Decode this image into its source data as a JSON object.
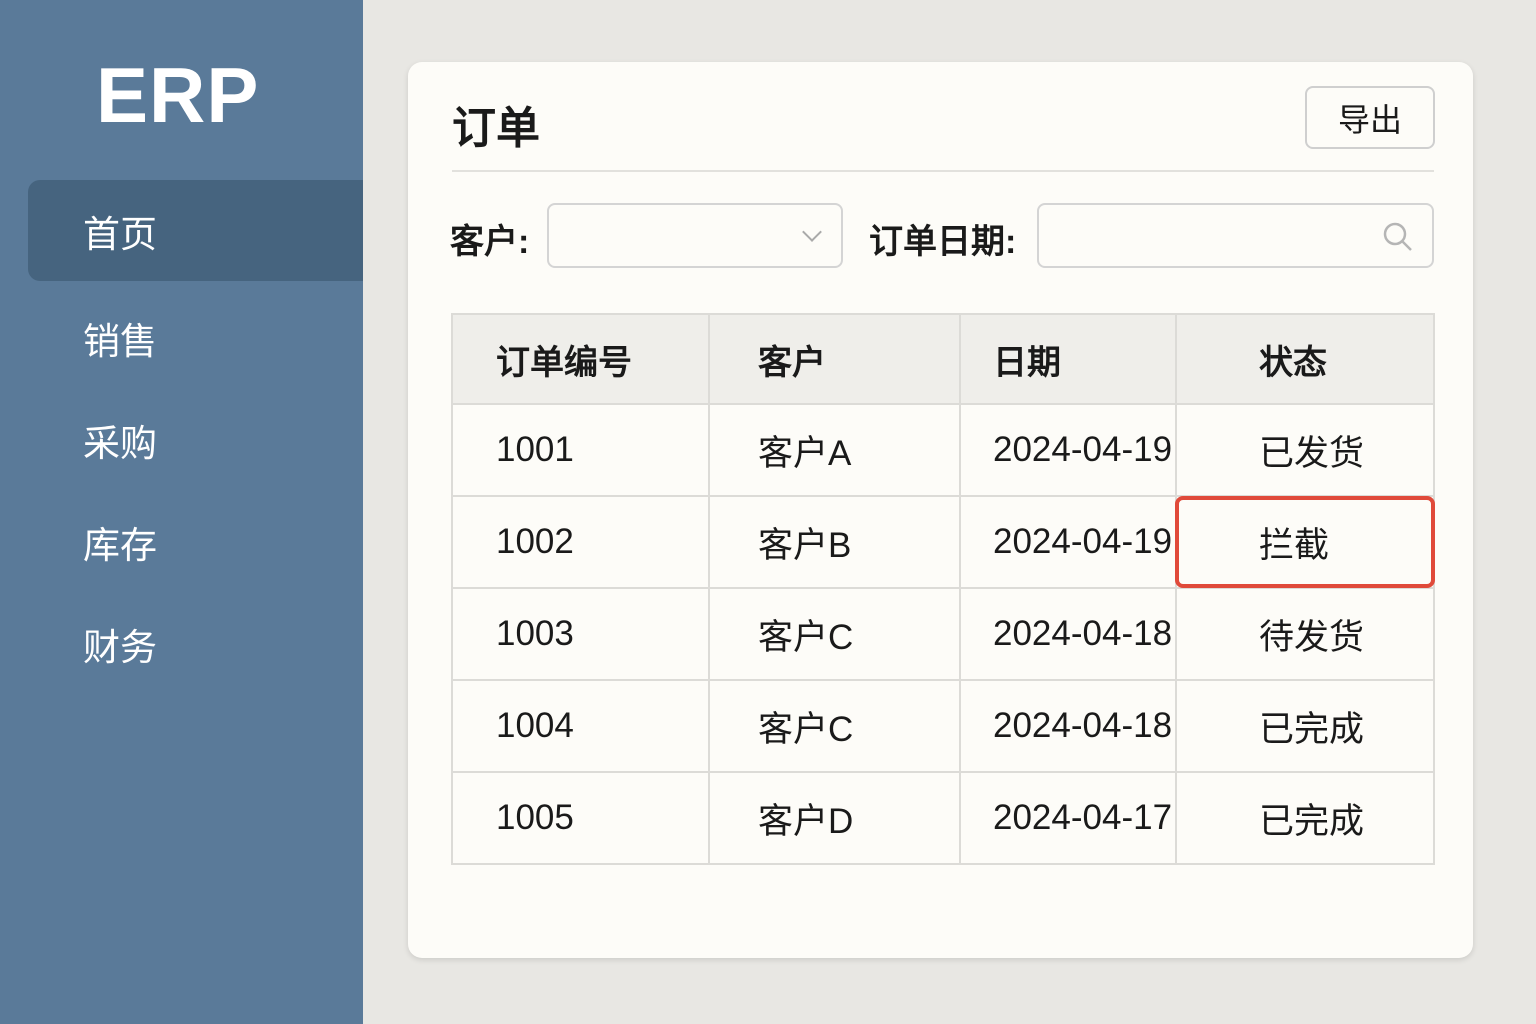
{
  "sidebar": {
    "logo": "ERP",
    "items": [
      {
        "label": "首页",
        "active": true
      },
      {
        "label": "销售"
      },
      {
        "label": "采购"
      },
      {
        "label": "库存"
      },
      {
        "label": "财务"
      }
    ]
  },
  "page": {
    "title": "订单",
    "export_label": "导出"
  },
  "filters": {
    "customer_label": "客户:",
    "customer_value": "",
    "date_label": "订单日期:",
    "date_value": ""
  },
  "table": {
    "headers": [
      "订单编号",
      "客户",
      "日期",
      "状态"
    ],
    "rows": [
      [
        "1001",
        "客户A",
        "2024-04-19",
        "已发货"
      ],
      [
        "1002",
        "客户B",
        "2024-04-19",
        "拦截"
      ],
      [
        "1003",
        "客户C",
        "2024-04-18",
        "待发货"
      ],
      [
        "1004",
        "客户C",
        "2024-04-18",
        "已完成"
      ],
      [
        "1005",
        "客户D",
        "2024-04-17",
        "已完成"
      ]
    ]
  },
  "colors": {
    "sidebar": "#5a7a99",
    "active": "#46647f",
    "highlight": "#e04a3a"
  }
}
